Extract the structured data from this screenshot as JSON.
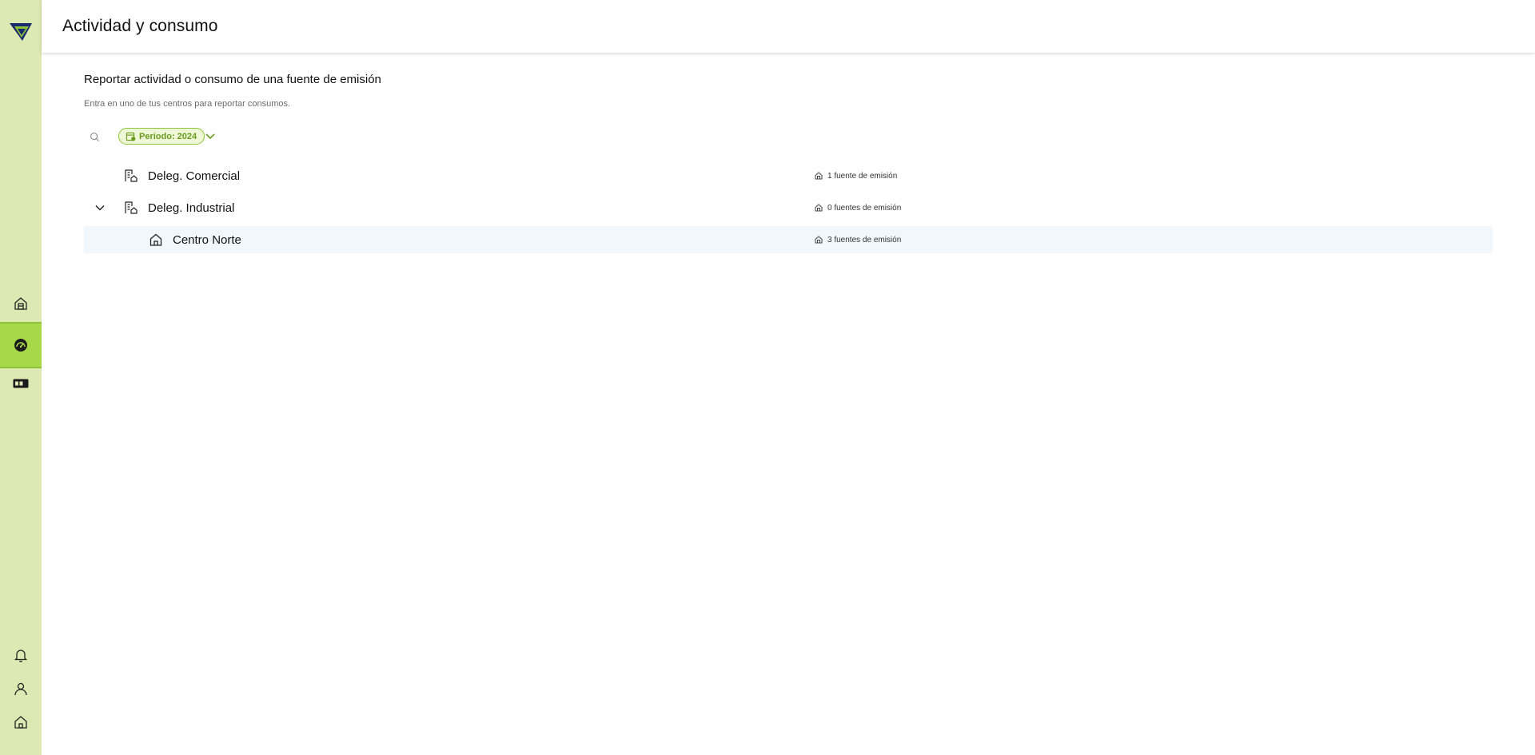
{
  "header": {
    "title": "Actividad y consumo"
  },
  "sidebar": {
    "items": [
      {
        "name": "sidebar-item-centers",
        "icon": "building-icon",
        "active": false
      },
      {
        "name": "sidebar-item-consumption",
        "icon": "gauge-icon",
        "active": true
      },
      {
        "name": "sidebar-item-reports",
        "icon": "card-icon",
        "active": false
      }
    ],
    "bottom_items": [
      {
        "name": "sidebar-item-notifications",
        "icon": "bell-icon"
      },
      {
        "name": "sidebar-item-profile",
        "icon": "user-icon"
      },
      {
        "name": "sidebar-item-home",
        "icon": "home-icon"
      }
    ]
  },
  "main": {
    "section_title": "Reportar actividad o consumo de una fuente de emisión",
    "section_subtitle": "Entra en uno de tus centros para reportar consumos.",
    "period_filter": "Periodo: 2024",
    "rows": [
      {
        "label": "Deleg. Comercial",
        "count": "1 fuente de emisión",
        "type": "delegation",
        "expanded": false
      },
      {
        "label": "Deleg. Industrial",
        "count": "0 fuentes de emisión",
        "type": "delegation",
        "expanded": true
      },
      {
        "label": "Centro Norte",
        "count": "3 fuentes de emisión",
        "type": "center",
        "selected": true
      }
    ]
  },
  "colors": {
    "sidebar_bg": "#dde9b2",
    "sidebar_active": "#a7d84a",
    "accent_green": "#8dc33a",
    "selected_row_bg": "#f1f8fc"
  }
}
